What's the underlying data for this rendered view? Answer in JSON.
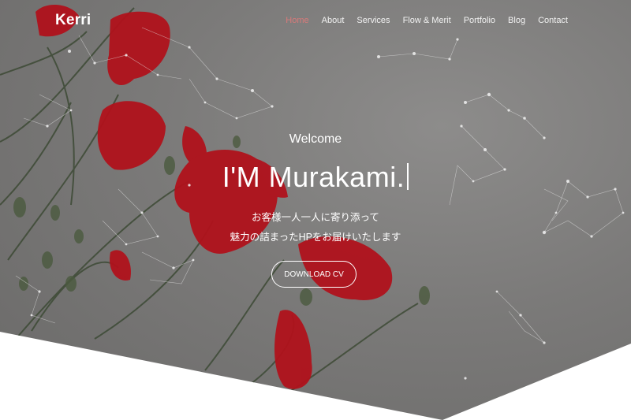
{
  "brand": {
    "logo": "Kerri"
  },
  "nav": {
    "items": [
      {
        "label": "Home",
        "active": true
      },
      {
        "label": "About"
      },
      {
        "label": "Services"
      },
      {
        "label": "Flow & Merit"
      },
      {
        "label": "Portfolio"
      },
      {
        "label": "Blog"
      },
      {
        "label": "Contact"
      }
    ]
  },
  "hero": {
    "welcome": "Welcome",
    "headline": "I'M Murakami.",
    "tagline_line1": "お客様一人一人に寄り添って",
    "tagline_line2": "魅力の詰まったHPをお届けいたします",
    "cta_label": "DOWNLOAD CV"
  },
  "colors": {
    "accent_active": "#d97a7a",
    "hero_bg": "#7b7a79",
    "flower": "#b0121c"
  }
}
